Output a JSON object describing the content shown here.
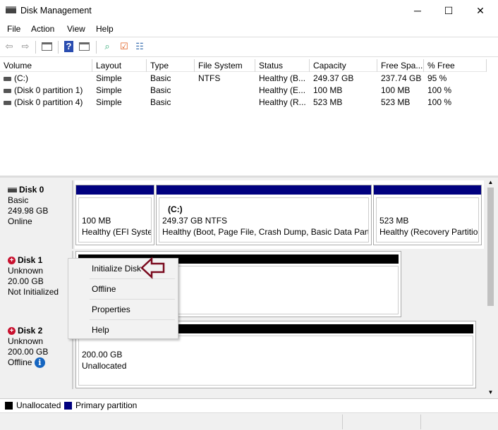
{
  "window": {
    "title": "Disk Management",
    "icon": "disk-management-icon",
    "minimize": "─",
    "maximize": "☐",
    "close": "✕"
  },
  "menu": [
    "File",
    "Action",
    "View",
    "Help"
  ],
  "toolbar": [
    "back-icon",
    "forward-icon",
    "console-tree-icon",
    "help-icon",
    "action-pane-icon",
    "connect-icon",
    "check-icon",
    "properties-list-icon"
  ],
  "columns": [
    "Volume",
    "Layout",
    "Type",
    "File System",
    "Status",
    "Capacity",
    "Free Spa...",
    "% Free"
  ],
  "volumes": [
    [
      "(C:)",
      "Simple",
      "Basic",
      "NTFS",
      "Healthy (B...",
      "249.37 GB",
      "237.74 GB",
      "95 %"
    ],
    [
      "(Disk 0 partition 1)",
      "Simple",
      "Basic",
      "",
      "Healthy (E...",
      "100 MB",
      "100 MB",
      "100 %"
    ],
    [
      "(Disk 0 partition 4)",
      "Simple",
      "Basic",
      "",
      "Healthy (R...",
      "523 MB",
      "523 MB",
      "100 %"
    ]
  ],
  "disks": [
    {
      "name": "Disk 0",
      "type": "Basic",
      "size": "249.98 GB",
      "state": "Online",
      "partitions": [
        {
          "name": "",
          "size": "100 MB",
          "status": "Healthy (EFI System Partition)"
        },
        {
          "name": "(C:)",
          "size": "249.37 GB NTFS",
          "status": "Healthy (Boot, Page File, Crash Dump, Basic Data Partition)"
        },
        {
          "name": "",
          "size": "523 MB",
          "status": "Healthy (Recovery Partition)"
        }
      ]
    },
    {
      "name": "Disk 1",
      "type": "Unknown",
      "size": "20.00 GB",
      "state": "Not Initialized"
    },
    {
      "name": "Disk 2",
      "type": "Unknown",
      "size": "200.00 GB",
      "state": "Offline",
      "partition": {
        "size": "200.00 GB",
        "status": "Unallocated"
      }
    }
  ],
  "context_menu": [
    "Initialize Disk",
    "Offline",
    "Properties",
    "Help"
  ],
  "legend": [
    {
      "label": "Unallocated",
      "color": "#000000"
    },
    {
      "label": "Primary partition",
      "color": "#00007f"
    }
  ],
  "colors": {
    "primary": "#00007f",
    "unallocated": "#000000",
    "annotation_arrow": "#7a0a1e"
  }
}
